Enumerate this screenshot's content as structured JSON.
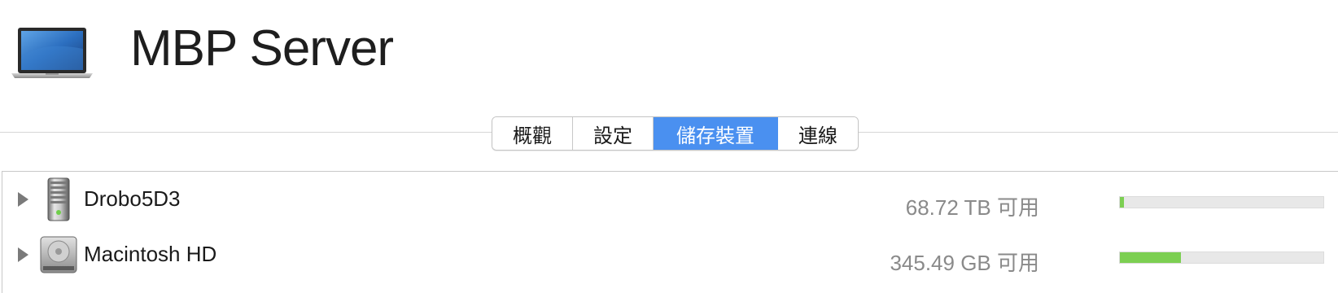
{
  "header": {
    "device_icon": "macbook-pro-icon",
    "device_name": "MBP Server"
  },
  "tabs": [
    {
      "label": "概觀",
      "active": false
    },
    {
      "label": "設定",
      "active": false
    },
    {
      "label": "儲存裝置",
      "active": true
    },
    {
      "label": "連線",
      "active": false
    }
  ],
  "storage": {
    "disks": [
      {
        "name": "Drobo5D3",
        "icon": "drobo-icon",
        "available": "68.72 TB 可用",
        "used_fraction": 0.02
      },
      {
        "name": "Macintosh HD",
        "icon": "hard-disk-icon",
        "available": "345.49 GB 可用",
        "used_fraction": 0.3
      }
    ]
  },
  "colors": {
    "accent": "#4a90f0",
    "usage_fill": "#7ccf52",
    "usage_track": "#e8e8e8"
  }
}
